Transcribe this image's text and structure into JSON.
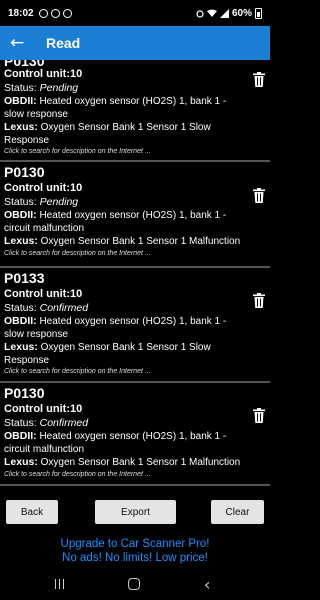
{
  "status_bar": {
    "time": "18:02",
    "battery": "60%"
  },
  "app_bar": {
    "back_icon": "arrow-left-icon",
    "title": "Read"
  },
  "list": {
    "partial_top_code": "P0130",
    "entries": [
      {
        "control_unit": "Control unit:10",
        "status_label": "Status:",
        "status_value": "Pending",
        "obd_label": "OBDII:",
        "obd_text": "Heated oxygen sensor (HO2S) 1, bank 1 - slow response",
        "make_label": "Lexus:",
        "make_text": "Oxygen Sensor Bank 1 Sensor 1 Slow Response",
        "hint": "Click to search for description on the Internet ..."
      },
      {
        "code": "P0130",
        "control_unit": "Control unit:10",
        "status_label": "Status:",
        "status_value": "Pending",
        "obd_label": "OBDII:",
        "obd_text": "Heated oxygen sensor (HO2S) 1, bank 1 - circuit malfunction",
        "make_label": "Lexus:",
        "make_text": "Oxygen Sensor Bank 1 Sensor 1 Malfunction",
        "hint": "Click to search for description on the Internet ..."
      },
      {
        "code": "P0133",
        "control_unit": "Control unit:10",
        "status_label": "Status:",
        "status_value": "Confirmed",
        "obd_label": "OBDII:",
        "obd_text": "Heated oxygen sensor (HO2S) 1, bank 1 - slow response",
        "make_label": "Lexus:",
        "make_text": "Oxygen Sensor Bank 1 Sensor 1 Slow Response",
        "hint": "Click to search for description on the Internet ..."
      },
      {
        "code": "P0130",
        "control_unit": "Control unit:10",
        "status_label": "Status:",
        "status_value": "Confirmed",
        "obd_label": "OBDII:",
        "obd_text": "Heated oxygen sensor (HO2S) 1, bank 1 - circuit malfunction",
        "make_label": "Lexus:",
        "make_text": "Oxygen Sensor Bank 1 Sensor 1 Malfunction",
        "hint": "Click to search for description on the Internet ..."
      }
    ],
    "delete_icon": "trash-icon"
  },
  "buttons": {
    "back": "Back",
    "export": "Export",
    "clear": "Clear"
  },
  "promo": {
    "line1": "Upgrade to Car Scanner Pro!",
    "line2": "No ads! No limits! Low price!"
  },
  "colors": {
    "app_bar": "#1b7fd3",
    "promo_text": "#1e90ff",
    "button_bg": "#e4e4e4",
    "background": "#000000"
  }
}
